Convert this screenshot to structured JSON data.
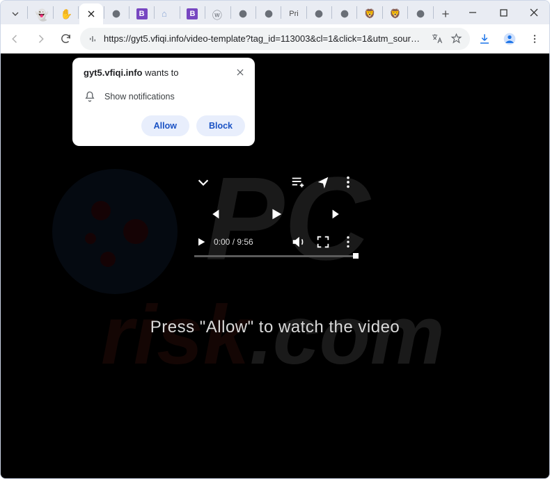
{
  "window": {
    "tabs": [
      {
        "icon": "chevron-down"
      },
      {
        "icon": "ghost"
      },
      {
        "icon": "hand"
      },
      {
        "icon": "close",
        "active": true
      },
      {
        "icon": "globe"
      },
      {
        "icon": "b-badge"
      },
      {
        "icon": "house"
      },
      {
        "icon": "b-badge"
      },
      {
        "icon": "wordpress"
      },
      {
        "icon": "globe"
      },
      {
        "icon": "globe"
      },
      {
        "label": "Pri"
      },
      {
        "icon": "globe"
      },
      {
        "icon": "globe"
      },
      {
        "icon": "lion"
      },
      {
        "icon": "lion"
      },
      {
        "icon": "globe"
      },
      {
        "icon": "new-tab"
      }
    ],
    "controls": {
      "minimize": "–",
      "maximize": "□",
      "close": "×"
    }
  },
  "toolbar": {
    "url": "https://gyt5.vfiqi.info/video-template?tag_id=113003&cl=1&click=1&utm_source=2270&r=1..."
  },
  "notification": {
    "domain": "gyt5.vfiqi.info",
    "wants_to": " wants to",
    "permission": "Show notifications",
    "allow": "Allow",
    "block": "Block"
  },
  "player": {
    "current_time": "0:00",
    "duration": "9:56",
    "time_text": "0:00 / 9:56"
  },
  "caption": "Press \"Allow\" to watch the video",
  "watermark": {
    "text_top": "PC",
    "text_bottom": "risk.com"
  }
}
